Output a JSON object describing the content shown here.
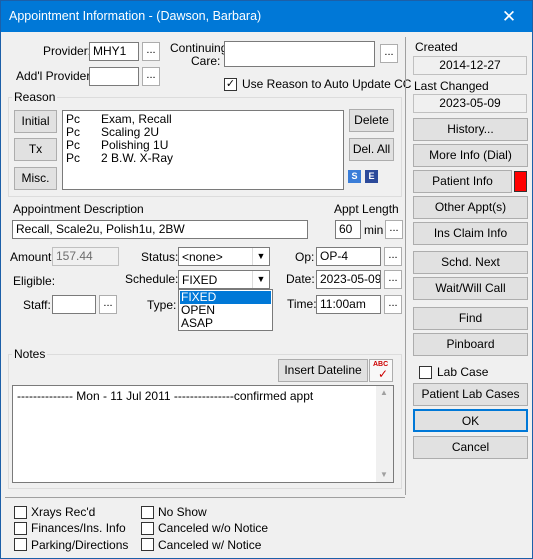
{
  "window": {
    "title": "Appointment Information - (Dawson, Barbara)"
  },
  "provider": {
    "label": "Provider:",
    "value": "MHY1"
  },
  "addl_provider": {
    "label": "Add'l Provider:",
    "value": ""
  },
  "continuing_care": {
    "label_line1": "Continuing",
    "label_line2": "Care:",
    "value": ""
  },
  "use_reason": {
    "label": "Use Reason to Auto Update CC",
    "checked": true
  },
  "reason": {
    "group_label": "Reason",
    "buttons": {
      "initial": "Initial",
      "tx": "Tx",
      "misc": "Misc.",
      "delete": "Delete",
      "del_all": "Del. All"
    },
    "items": [
      {
        "code": "Pc",
        "desc": "Exam, Recall"
      },
      {
        "code": "Pc",
        "desc": "Scaling 2U"
      },
      {
        "code": "Pc",
        "desc": "Polishing 1U"
      },
      {
        "code": "Pc",
        "desc": "2 B.W. X-Ray"
      }
    ],
    "icons": {
      "s": "S",
      "e": "E"
    }
  },
  "appt_description": {
    "label": "Appointment Description",
    "value": "Recall, Scale2u, Polish1u, 2BW"
  },
  "appt_length": {
    "label": "Appt Length",
    "value": "60",
    "unit": "min"
  },
  "amount": {
    "label": "Amount:",
    "value": "157.44"
  },
  "eligible": {
    "label": "Eligible:"
  },
  "staff": {
    "label": "Staff:",
    "value": ""
  },
  "status": {
    "label": "Status:",
    "value": "<none>"
  },
  "schedule": {
    "label": "Schedule:",
    "value": "FIXED",
    "options": [
      "FIXED",
      "OPEN",
      "ASAP"
    ]
  },
  "type": {
    "label": "Type:"
  },
  "op": {
    "label": "Op:",
    "value": "OP-4"
  },
  "date": {
    "label": "Date:",
    "value": "2023-05-09"
  },
  "time": {
    "label": "Time:",
    "value": "11:00am"
  },
  "notes": {
    "group_label": "Notes",
    "insert_dateline": "Insert Dateline",
    "spell_label": "ABC",
    "text": "-------------- Mon - 11 Jul 2011 ---------------confirmed appt"
  },
  "created": {
    "label": "Created",
    "value": "2014-12-27"
  },
  "last_changed": {
    "label": "Last Changed",
    "value": "2023-05-09"
  },
  "right_buttons": {
    "history": "History...",
    "more_info": "More Info (Dial)",
    "patient_info": "Patient Info",
    "other_appts": "Other Appt(s)",
    "ins_claim": "Ins Claim Info",
    "schd_next": "Schd. Next",
    "wait_will_call": "Wait/Will Call",
    "find": "Find",
    "pinboard": "Pinboard",
    "lab_case": "Lab Case",
    "patient_lab_cases": "Patient Lab Cases",
    "ok": "OK",
    "cancel": "Cancel"
  },
  "bottom_checks": {
    "xrays": "Xrays Rec'd",
    "finances": "Finances/Ins. Info",
    "parking": "Parking/Directions",
    "no_show": "No Show",
    "canceled_wo": "Canceled w/o Notice",
    "canceled_w": "Canceled w/ Notice"
  },
  "colors": {
    "titlebar": "#0078d7",
    "patient_flag": "#ff0000",
    "highlight": "#0078d7"
  }
}
